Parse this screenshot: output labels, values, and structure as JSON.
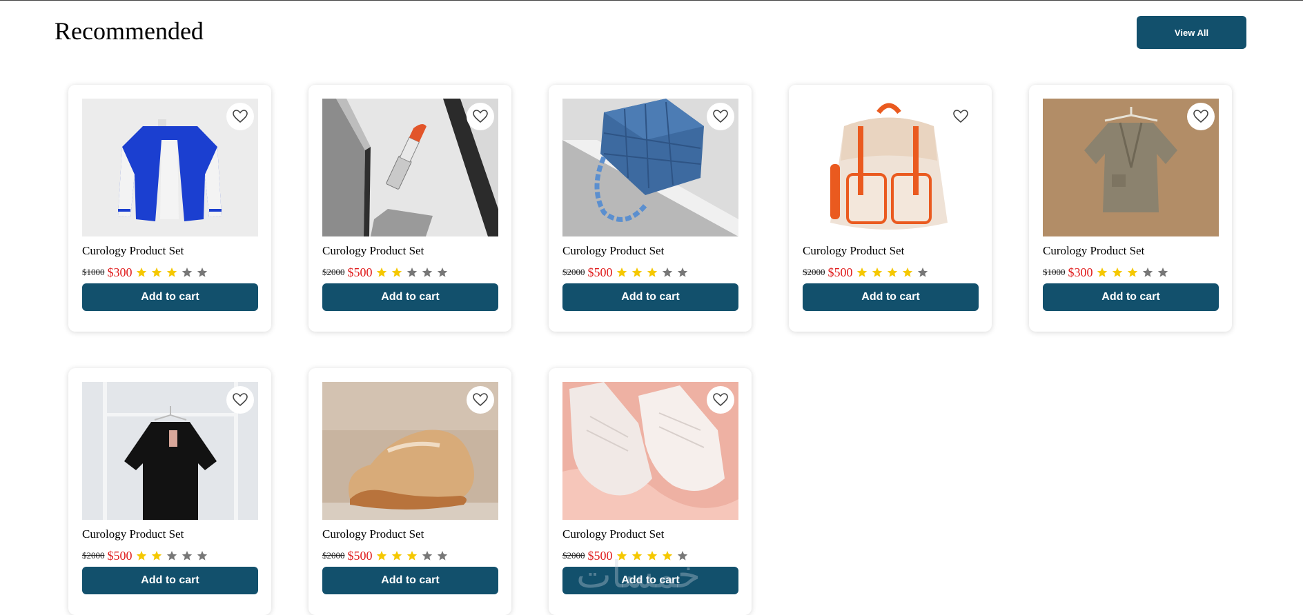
{
  "section": {
    "title": "Recommended",
    "view_all_label": "View All"
  },
  "colors": {
    "brand": "#12506c",
    "price_red": "#e01b1b",
    "star_filled": "#f5c800",
    "star_empty": "#777777"
  },
  "products": [
    {
      "name": "Curology Product Set",
      "old_price": "$1000",
      "price": "$300",
      "rating": 3,
      "image": "varsity-jacket",
      "button_label": "Add to cart"
    },
    {
      "name": "Curology Product Set",
      "old_price": "$2000",
      "price": "$500",
      "rating": 2,
      "image": "lipstick",
      "button_label": "Add to cart"
    },
    {
      "name": "Curology Product Set",
      "old_price": "$2000",
      "price": "$500",
      "rating": 3,
      "image": "blue-handbag",
      "button_label": "Add to cart"
    },
    {
      "name": "Curology Product Set",
      "old_price": "$2000",
      "price": "$500",
      "rating": 4,
      "image": "orange-backpack",
      "button_label": "Add to cart"
    },
    {
      "name": "Curology Product Set",
      "old_price": "$1000",
      "price": "$300",
      "rating": 3,
      "image": "linen-blouse",
      "button_label": "Add to cart"
    },
    {
      "name": "Curology Product Set",
      "old_price": "$2000",
      "price": "$500",
      "rating": 2,
      "image": "black-dress",
      "button_label": "Add to cart"
    },
    {
      "name": "Curology Product Set",
      "old_price": "$2000",
      "price": "$500",
      "rating": 3,
      "image": "beige-sneaker",
      "button_label": "Add to cart"
    },
    {
      "name": "Curology Product Set",
      "old_price": "$2000",
      "price": "$500",
      "rating": 4,
      "image": "white-sneakers",
      "button_label": "Add to cart"
    }
  ]
}
